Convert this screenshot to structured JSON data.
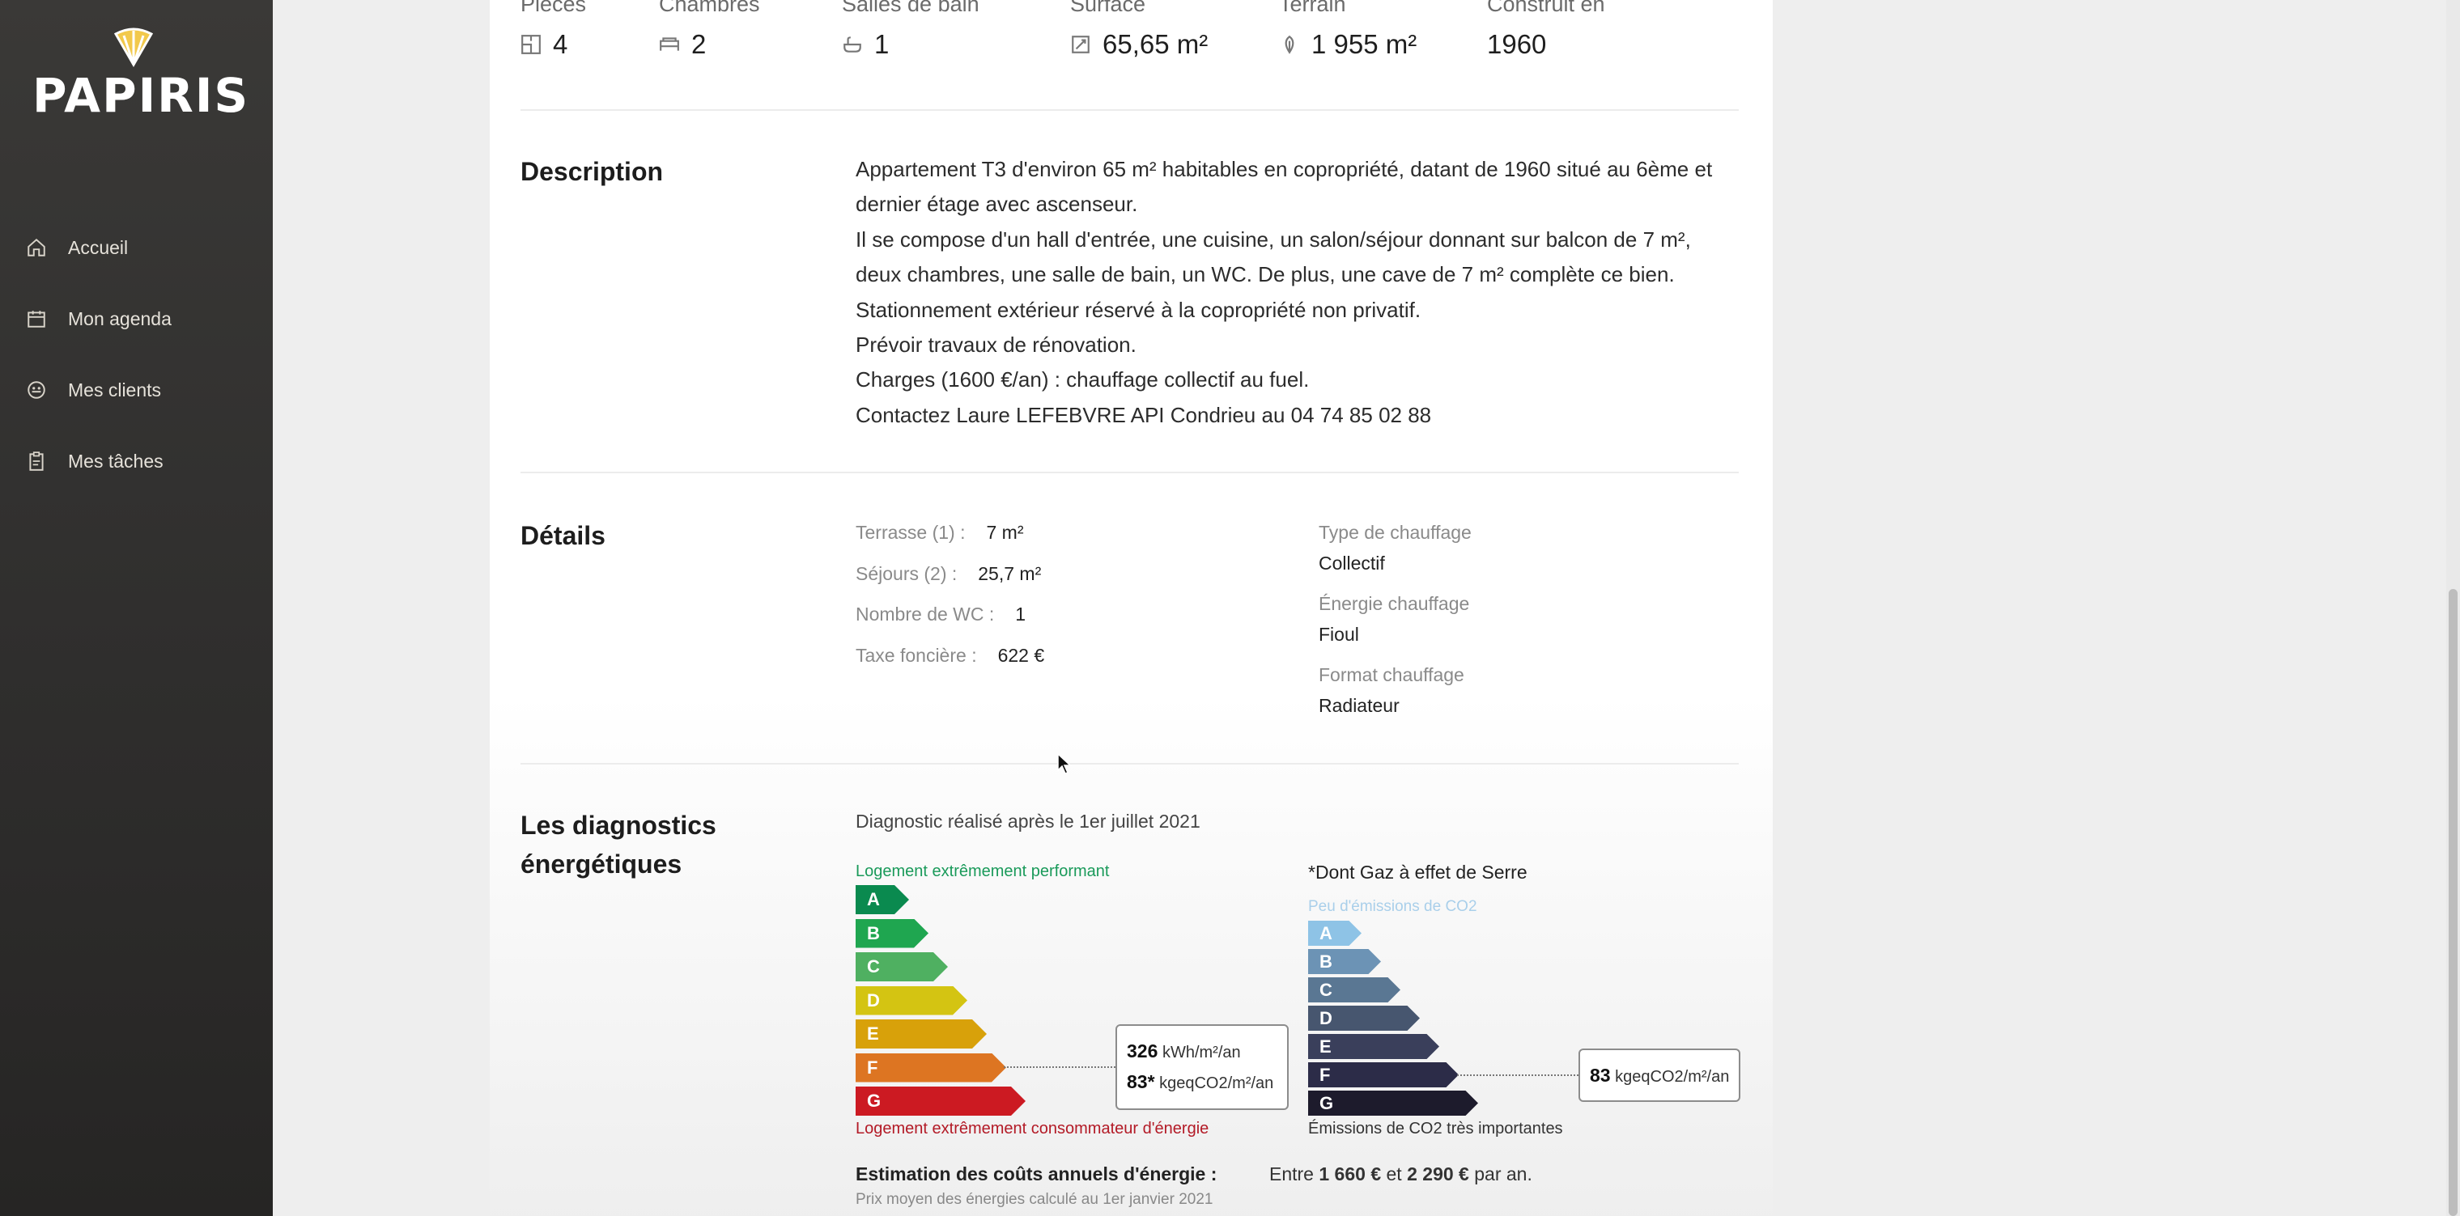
{
  "sidebar": {
    "brand": "PAPIRIS",
    "items": [
      {
        "label": "Accueil",
        "icon": "home-icon"
      },
      {
        "label": "Mon agenda",
        "icon": "calendar-icon"
      },
      {
        "label": "Mes clients",
        "icon": "clients-icon"
      },
      {
        "label": "Mes tâches",
        "icon": "clipboard-icon"
      }
    ]
  },
  "stats": [
    {
      "label": "Pièces",
      "value": "4",
      "icon": "rooms-icon"
    },
    {
      "label": "Chambres",
      "value": "2",
      "icon": "bed-icon"
    },
    {
      "label": "Salles de bain",
      "value": "1",
      "icon": "bath-icon"
    },
    {
      "label": "Surface",
      "value": "65,65 m²",
      "icon": "surface-icon"
    },
    {
      "label": "Terrain",
      "value": "1 955 m²",
      "icon": "leaf-icon"
    },
    {
      "label": "Construit en",
      "value": "1960",
      "icon": ""
    }
  ],
  "description": {
    "title": "Description",
    "lines": [
      "Appartement T3 d'environ 65 m² habitables en copropriété, datant de 1960 situé au 6ème et dernier étage avec ascenseur.",
      "Il se compose d'un hall d'entrée, une cuisine, un salon/séjour donnant sur balcon de 7 m², deux chambres, une salle de bain, un WC. De plus, une cave de 7 m² complète ce bien.",
      "Stationnement extérieur réservé à la copropriété non privatif.",
      "Prévoir travaux de rénovation.",
      "Charges (1600 €/an) : chauffage collectif au fuel.",
      "Contactez Laure LEFEBVRE API Condrieu au 04 74 85 02 88"
    ]
  },
  "details": {
    "title": "Détails",
    "left": [
      {
        "k": "Terrasse (1) :",
        "v": "7 m²"
      },
      {
        "k": "Séjours (2) :",
        "v": "25,7 m²"
      },
      {
        "k": "Nombre de WC :",
        "v": "1"
      },
      {
        "k": "Taxe foncière :",
        "v": "622 €"
      }
    ],
    "right": [
      {
        "k": "Type de chauffage",
        "v": "Collectif"
      },
      {
        "k": "Énergie chauffage",
        "v": "Fioul"
      },
      {
        "k": "Format chauffage",
        "v": "Radiateur"
      }
    ]
  },
  "diagnostics": {
    "title_line1": "Les diagnostics",
    "title_line2": "énergétiques",
    "date_note": "Diagnostic réalisé après le 1er juillet 2021",
    "dpe": {
      "top_label": "Logement extrêmement performant",
      "bottom_label": "Logement extrêmement consommateur d'énergie",
      "classes": [
        "A",
        "B",
        "C",
        "D",
        "E",
        "F",
        "G"
      ],
      "colors": [
        "#0a8a4f",
        "#1fa650",
        "#4fb061",
        "#d4c412",
        "#d8a10a",
        "#dd7522",
        "#cc1a22"
      ],
      "current_class": "F",
      "value_energy": "326",
      "unit_energy": "kWh/m²/an",
      "value_ges": "83*",
      "unit_ges": "kgeqCO2/m²/an"
    },
    "ges": {
      "title": "*Dont Gaz à effet de Serre",
      "top_label": "Peu d'émissions de CO2",
      "bottom_label": "Émissions de CO2 très importantes",
      "classes": [
        "A",
        "B",
        "C",
        "D",
        "E",
        "F",
        "G"
      ],
      "colors": [
        "#8ec3e6",
        "#6c93b5",
        "#5a7793",
        "#47566f",
        "#3a3f5b",
        "#2c2c48",
        "#1d1b2c"
      ],
      "current_class": "F",
      "value": "83",
      "unit": "kgeqCO2/m²/an"
    },
    "cost": {
      "label": "Estimation des coûts annuels d'énergie :",
      "prefix": "Entre",
      "min": "1 660 €",
      "middle": "et",
      "max": "2 290 €",
      "suffix": "par an.",
      "note": "Prix moyen des énergies calculé au 1er janvier 2021"
    }
  }
}
